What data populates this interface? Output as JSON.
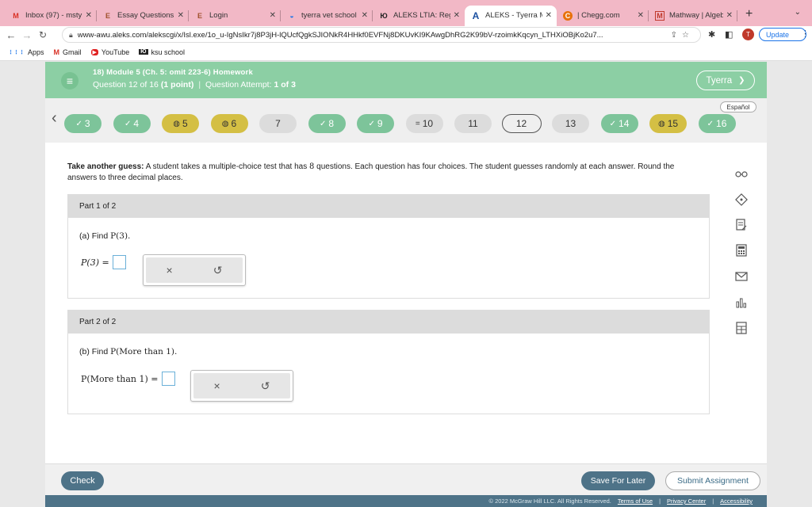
{
  "browser": {
    "tabs": [
      {
        "label": "Inbox (97) - msty",
        "icon": "M",
        "icon_color": "#d93025"
      },
      {
        "label": "Essay Questions",
        "icon": "E",
        "icon_color": "#a0522d"
      },
      {
        "label": "Login",
        "icon": "E",
        "icon_color": "#a0522d"
      },
      {
        "label": "tyerra vet school",
        "icon": "◒",
        "icon_color": "#1a73e8"
      },
      {
        "label": "ALEKS LTIA: Reg",
        "icon": "Ю",
        "icon_color": "#222"
      },
      {
        "label": "ALEKS - Tyerra M",
        "icon": "A",
        "icon_color": "#1a4fa0"
      },
      {
        "label": "| Chegg.com",
        "icon": "C",
        "icon_color": "#e8710a"
      },
      {
        "label": "Mathway | Algebr",
        "icon": "M",
        "icon_color": "#c0392b"
      }
    ],
    "active_tab": 5,
    "url": "www-awu.aleks.com/alekscgi/x/Isl.exe/1o_u-IgNsIkr7j8P3jH-lQUcfQgkSJIONkR4HHkf0EVFNj8DKUvKI9KAwgDhRG2K99bV-rzoimkKqcyn_LTHXiOBjKo2u7...",
    "update_label": "Update",
    "profile_letter": "T",
    "bookmarks": [
      {
        "label": "Apps",
        "icon": "⋮⋮⋮"
      },
      {
        "label": "Gmail",
        "icon": "M"
      },
      {
        "label": "YouTube",
        "icon": "▶"
      },
      {
        "label": "ksu school",
        "icon": "Ю"
      }
    ]
  },
  "aleks": {
    "module_title": "18) Module 5 (Ch. 5: omit 223-6) Homework",
    "question_prefix": "Question 12 of 16",
    "question_points": "(1 point)",
    "attempt_prefix": "Question Attempt:",
    "attempt_value": "1 of 3",
    "user_name": "Tyerra",
    "espanol_label": "Español",
    "question_nav": [
      {
        "label": "3",
        "state": "correct",
        "icon": "✓"
      },
      {
        "label": "4",
        "state": "correct",
        "icon": "✓"
      },
      {
        "label": "5",
        "state": "partial",
        "icon": "◍"
      },
      {
        "label": "6",
        "state": "partial",
        "icon": "◍"
      },
      {
        "label": "7",
        "state": "open",
        "icon": ""
      },
      {
        "label": "8",
        "state": "correct",
        "icon": "✓"
      },
      {
        "label": "9",
        "state": "correct",
        "icon": "✓"
      },
      {
        "label": "10",
        "state": "open",
        "icon": "="
      },
      {
        "label": "11",
        "state": "open",
        "icon": ""
      },
      {
        "label": "12",
        "state": "current",
        "icon": ""
      },
      {
        "label": "13",
        "state": "open",
        "icon": ""
      },
      {
        "label": "14",
        "state": "correct",
        "icon": "✓"
      },
      {
        "label": "15",
        "state": "partial",
        "icon": "◍"
      },
      {
        "label": "16",
        "state": "correct",
        "icon": "✓"
      }
    ],
    "prompt_lead": "Take another guess:",
    "prompt_text_1": "A student takes a multiple-choice test that has",
    "prompt_number": "8",
    "prompt_text_2": "questions. Each question has four choices. The student guesses randomly at each answer. Round the answers to three decimal places.",
    "part1": {
      "heading": "Part 1 of 2",
      "question_prefix": "(a) Find",
      "question_math": "P(3).",
      "answer_label": "P(3) ="
    },
    "part2": {
      "heading": "Part 2 of 2",
      "question_prefix": "(b) Find",
      "question_math": "P(More than 1).",
      "answer_label": "P(More than 1) ="
    },
    "tool_clear": "×",
    "tool_undo": "↺",
    "side_tools": [
      "glasses-icon",
      "compass-icon",
      "notes-icon",
      "calculator-icon",
      "mail-icon",
      "chart-icon",
      "data-icon"
    ],
    "buttons": {
      "check": "Check",
      "save_later": "Save For Later",
      "submit": "Submit Assignment"
    },
    "footer": {
      "copyright": "© 2022 McGraw Hill LLC. All Rights Reserved.",
      "terms": "Terms of Use",
      "privacy": "Privacy Center",
      "accessibility": "Accessibility"
    },
    "colors": {
      "header_green": "#8ccfa4",
      "correct_green": "#7dc49a",
      "partial_yellow": "#d4bf44",
      "button_blue": "#4e7388"
    }
  }
}
